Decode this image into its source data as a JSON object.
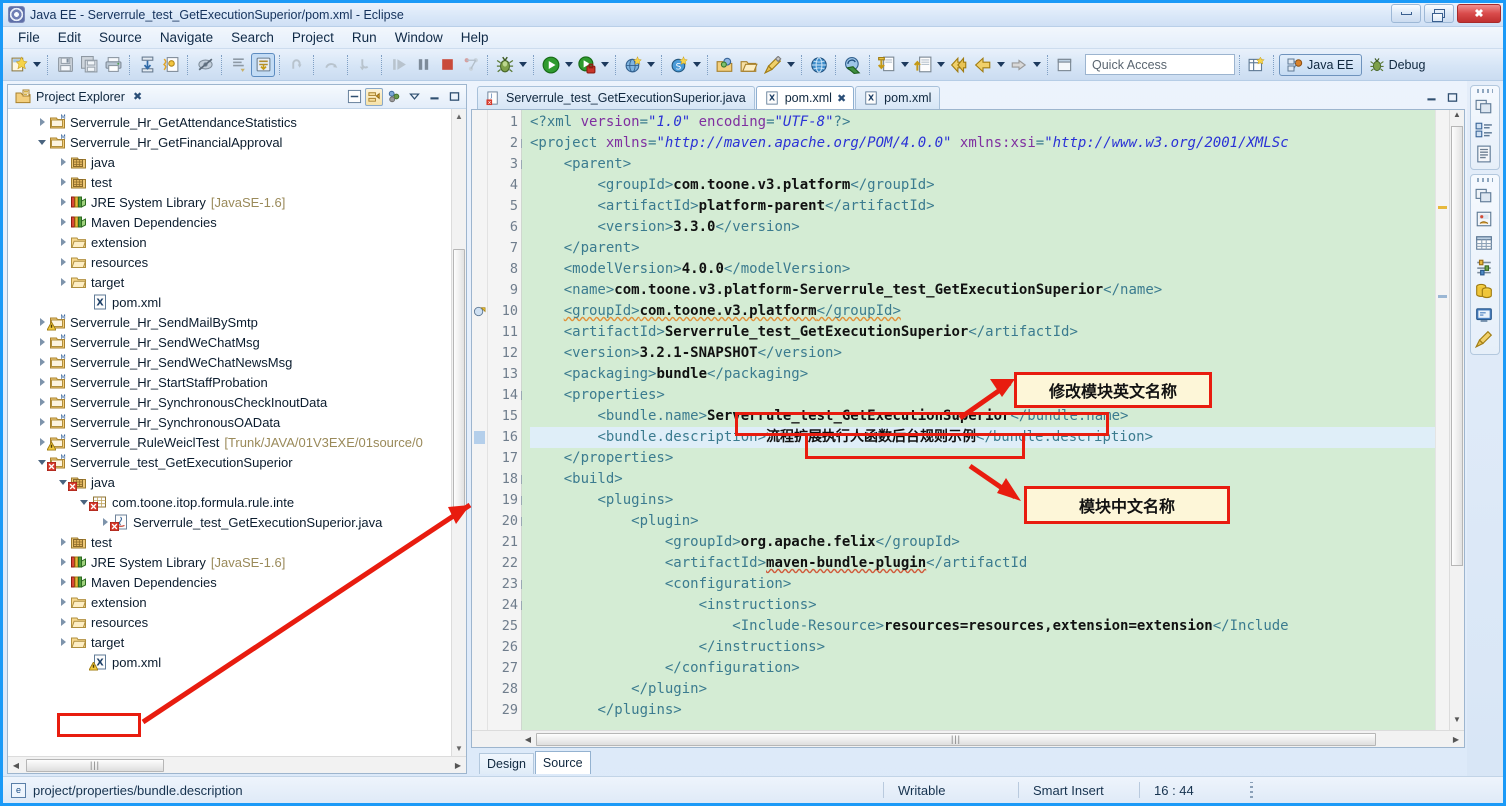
{
  "window": {
    "title": "Java EE - Serverrule_test_GetExecutionSuperior/pom.xml - Eclipse",
    "minimize_label": "Minimize",
    "maximize_label": "Restore",
    "close_label": "Close"
  },
  "menubar": {
    "items": [
      "File",
      "Edit",
      "Source",
      "Navigate",
      "Search",
      "Project",
      "Run",
      "Window",
      "Help"
    ]
  },
  "toolbar": {
    "quick_access_placeholder": "Quick Access",
    "perspectives": [
      {
        "label": "Java EE",
        "active": true
      },
      {
        "label": "Debug",
        "active": false
      }
    ],
    "items": [
      {
        "name": "new-wizard-icon",
        "has_arrow": true
      },
      {
        "name": "save-icon",
        "has_arrow": false
      },
      {
        "name": "save-all-icon",
        "has_arrow": false
      },
      {
        "name": "print-icon",
        "has_arrow": false
      },
      {
        "name": "publish-icon",
        "has_arrow": false
      },
      {
        "name": "validate-icon",
        "has_arrow": false
      },
      {
        "name": "toggle-mark-occurrences-icon",
        "has_arrow": false
      },
      {
        "name": "open-task-icon",
        "has_arrow": false
      },
      {
        "name": "skip-all-breakpoints-icon",
        "has_arrow": false
      },
      {
        "name": "step-return-icon",
        "has_arrow": false
      },
      {
        "name": "step-over-icon",
        "has_arrow": false
      },
      {
        "name": "step-into-icon",
        "has_arrow": false
      },
      {
        "name": "resume-icon",
        "has_arrow": false
      },
      {
        "name": "suspend-icon",
        "has_arrow": false
      },
      {
        "name": "terminate-icon",
        "has_arrow": false
      },
      {
        "name": "disconnect-icon",
        "has_arrow": false
      },
      {
        "name": "debug-icon",
        "has_arrow": true
      },
      {
        "name": "run-icon",
        "has_arrow": true
      },
      {
        "name": "run-external-tools-icon",
        "has_arrow": true
      },
      {
        "name": "new-server-icon",
        "has_arrow": true
      },
      {
        "name": "new-dynamic-web-project-icon",
        "has_arrow": true
      },
      {
        "name": "open-type-icon",
        "has_arrow": false
      },
      {
        "name": "open-resource-icon",
        "has_arrow": false
      },
      {
        "name": "search-icon",
        "has_arrow": true
      },
      {
        "name": "web-browser-icon",
        "has_arrow": false
      },
      {
        "name": "svn-update-icon",
        "has_arrow": false
      },
      {
        "name": "svn-commit-icon",
        "has_arrow": true
      },
      {
        "name": "svn-checkout-icon",
        "has_arrow": true
      },
      {
        "name": "previous-annotation-icon",
        "has_arrow": false
      },
      {
        "name": "back-icon",
        "has_arrow": true
      },
      {
        "name": "forward-icon",
        "has_arrow": true
      },
      {
        "name": "restore-icon",
        "has_arrow": false
      }
    ]
  },
  "explorer": {
    "view_title": "Project Explorer",
    "close_glyph": "✖",
    "toolbar_icons": [
      "collapse-all-icon",
      "link-with-editor-icon",
      "view-menu-filters-icon",
      "view-menu-icon",
      "minimize-icon",
      "maximize-icon"
    ],
    "tree": [
      {
        "label": "Serverrule_Hr_GetAttendanceStatistics",
        "indent": 1,
        "twisty": "right",
        "icon": "project",
        "overlay": "",
        "suffix": ""
      },
      {
        "label": "Serverrule_Hr_GetFinancialApproval",
        "indent": 1,
        "twisty": "down",
        "icon": "project",
        "overlay": "",
        "suffix": ""
      },
      {
        "label": "java",
        "indent": 2,
        "twisty": "right",
        "icon": "pkgroot",
        "overlay": "",
        "suffix": ""
      },
      {
        "label": "test",
        "indent": 2,
        "twisty": "right",
        "icon": "pkgroot",
        "overlay": "",
        "suffix": ""
      },
      {
        "label": "JRE System Library",
        "indent": 2,
        "twisty": "right",
        "icon": "lib",
        "overlay": "",
        "suffix": "[JavaSE-1.6]"
      },
      {
        "label": "Maven Dependencies",
        "indent": 2,
        "twisty": "right",
        "icon": "lib",
        "overlay": "",
        "suffix": ""
      },
      {
        "label": "extension",
        "indent": 2,
        "twisty": "right",
        "icon": "folder",
        "overlay": "",
        "suffix": ""
      },
      {
        "label": "resources",
        "indent": 2,
        "twisty": "right",
        "icon": "folder",
        "overlay": "",
        "suffix": ""
      },
      {
        "label": "target",
        "indent": 2,
        "twisty": "right",
        "icon": "folder",
        "overlay": "",
        "suffix": ""
      },
      {
        "label": "pom.xml",
        "indent": 3,
        "twisty": "none",
        "icon": "xml",
        "overlay": "",
        "suffix": ""
      },
      {
        "label": "Serverrule_Hr_SendMailBySmtp",
        "indent": 1,
        "twisty": "right",
        "icon": "project",
        "overlay": "warn",
        "suffix": ""
      },
      {
        "label": "Serverrule_Hr_SendWeChatMsg",
        "indent": 1,
        "twisty": "right",
        "icon": "project",
        "overlay": "",
        "suffix": ""
      },
      {
        "label": "Serverrule_Hr_SendWeChatNewsMsg",
        "indent": 1,
        "twisty": "right",
        "icon": "project",
        "overlay": "",
        "suffix": ""
      },
      {
        "label": "Serverrule_Hr_StartStaffProbation",
        "indent": 1,
        "twisty": "right",
        "icon": "project",
        "overlay": "",
        "suffix": ""
      },
      {
        "label": "Serverrule_Hr_SynchronousCheckInoutData",
        "indent": 1,
        "twisty": "right",
        "icon": "project",
        "overlay": "",
        "suffix": ""
      },
      {
        "label": "Serverrule_Hr_SynchronousOAData",
        "indent": 1,
        "twisty": "right",
        "icon": "project",
        "overlay": "",
        "suffix": ""
      },
      {
        "label": "Serverrule_RuleWeiclTest",
        "indent": 1,
        "twisty": "right",
        "icon": "project",
        "overlay": "warn",
        "suffix": "[Trunk/JAVA/01V3EXE/01source/0"
      },
      {
        "label": "Serverrule_test_GetExecutionSuperior",
        "indent": 1,
        "twisty": "down",
        "icon": "project",
        "overlay": "err",
        "suffix": ""
      },
      {
        "label": "java",
        "indent": 2,
        "twisty": "down",
        "icon": "pkgroot",
        "overlay": "err",
        "suffix": ""
      },
      {
        "label": "com.toone.itop.formula.rule.inte",
        "indent": 3,
        "twisty": "down",
        "icon": "pkg",
        "overlay": "err",
        "suffix": ""
      },
      {
        "label": "Serverrule_test_GetExecutionSuperior.java",
        "indent": 4,
        "twisty": "right",
        "icon": "java",
        "overlay": "err",
        "suffix": ""
      },
      {
        "label": "test",
        "indent": 2,
        "twisty": "right",
        "icon": "pkgroot",
        "overlay": "",
        "suffix": ""
      },
      {
        "label": "JRE System Library",
        "indent": 2,
        "twisty": "right",
        "icon": "lib",
        "overlay": "",
        "suffix": "[JavaSE-1.6]"
      },
      {
        "label": "Maven Dependencies",
        "indent": 2,
        "twisty": "right",
        "icon": "lib",
        "overlay": "",
        "suffix": ""
      },
      {
        "label": "extension",
        "indent": 2,
        "twisty": "right",
        "icon": "folder",
        "overlay": "",
        "suffix": ""
      },
      {
        "label": "resources",
        "indent": 2,
        "twisty": "right",
        "icon": "folder",
        "overlay": "",
        "suffix": ""
      },
      {
        "label": "target",
        "indent": 2,
        "twisty": "right",
        "icon": "folder",
        "overlay": "",
        "suffix": ""
      },
      {
        "label": "pom.xml",
        "indent": 3,
        "twisty": "none",
        "icon": "xml",
        "overlay": "warn",
        "suffix": ""
      }
    ]
  },
  "editor": {
    "tabs": [
      {
        "label": "Serverrule_test_GetExecutionSuperior.java",
        "icon": "java-file-icon",
        "active": false,
        "closable": false
      },
      {
        "label": "pom.xml",
        "icon": "xml-file-icon",
        "active": true,
        "closable": true
      },
      {
        "label": "pom.xml",
        "icon": "xml-file-icon",
        "active": false,
        "closable": false
      }
    ],
    "close_glyph": "✖",
    "bottom_tabs": [
      {
        "label": "Design",
        "active": false
      },
      {
        "label": "Source",
        "active": true
      }
    ],
    "lines": [
      {
        "n": 1,
        "fold": "",
        "marker": "",
        "current": false,
        "html": "<span class=\"pi\">&lt;?xml </span><span class=\"attn\">version</span><span class=\"pi\">=</span><span class=\"attv\">\"1.0\"</span> <span class=\"attn\">encoding</span><span class=\"pi\">=</span><span class=\"attv\">\"UTF-8\"</span><span class=\"pi\">?&gt;</span>"
      },
      {
        "n": 2,
        "fold": "-",
        "marker": "",
        "current": false,
        "html": "<span class=\"tag\">&lt;project </span><span class=\"attn\">xmlns</span><span class=\"tag\">=</span><span class=\"attv\">\"http://maven.apache.org/POM/4.0.0\"</span> <span class=\"attn\">xmlns:xsi</span><span class=\"tag\">=</span><span class=\"attv\">\"http://www.w3.org/2001/XMLSc</span>"
      },
      {
        "n": 3,
        "fold": "-",
        "marker": "",
        "current": false,
        "html": "    <span class=\"tag\">&lt;parent&gt;</span>"
      },
      {
        "n": 4,
        "fold": "",
        "marker": "",
        "current": false,
        "html": "        <span class=\"tag\">&lt;groupId&gt;</span><span class=\"txt\">com.toone.v3.platform</span><span class=\"tag\">&lt;/groupId&gt;</span>"
      },
      {
        "n": 5,
        "fold": "",
        "marker": "",
        "current": false,
        "html": "        <span class=\"tag\">&lt;artifactId&gt;</span><span class=\"txt\">platform-parent</span><span class=\"tag\">&lt;/artifactId&gt;</span>"
      },
      {
        "n": 6,
        "fold": "",
        "marker": "",
        "current": false,
        "html": "        <span class=\"tag\">&lt;version&gt;</span><span class=\"txt\">3.3.0</span><span class=\"tag\">&lt;/version&gt;</span>"
      },
      {
        "n": 7,
        "fold": "",
        "marker": "",
        "current": false,
        "html": "    <span class=\"tag\">&lt;/parent&gt;</span>"
      },
      {
        "n": 8,
        "fold": "",
        "marker": "",
        "current": false,
        "html": "    <span class=\"tag\">&lt;modelVersion&gt;</span><span class=\"txt\">4.0.0</span><span class=\"tag\">&lt;/modelVersion&gt;</span>"
      },
      {
        "n": 9,
        "fold": "",
        "marker": "",
        "current": false,
        "html": "    <span class=\"tag\">&lt;name&gt;</span><span class=\"txt\">com.toone.v3.platform-Serverrule_test_GetExecutionSuperior</span><span class=\"tag\">&lt;/name&gt;</span>"
      },
      {
        "n": 10,
        "fold": "",
        "marker": "warning",
        "current": false,
        "html": "    <span class=\"tag squig\">&lt;groupId&gt;</span><span class=\"txt squig\">com.toone.v3.platform</span><span class=\"tag squig\">&lt;/groupId&gt;</span>"
      },
      {
        "n": 11,
        "fold": "",
        "marker": "",
        "current": false,
        "html": "    <span class=\"tag\">&lt;artifactId&gt;</span><span class=\"txt\">Serverrule_test_GetExecutionSuperior</span><span class=\"tag\">&lt;/artifactId&gt;</span>"
      },
      {
        "n": 12,
        "fold": "",
        "marker": "",
        "current": false,
        "html": "    <span class=\"tag\">&lt;version&gt;</span><span class=\"txt\">3.2.1-SNAPSHOT</span><span class=\"tag\">&lt;/version&gt;</span>"
      },
      {
        "n": 13,
        "fold": "",
        "marker": "",
        "current": false,
        "html": "    <span class=\"tag\">&lt;packaging&gt;</span><span class=\"txt\">bundle</span><span class=\"tag\">&lt;/packaging&gt;</span>"
      },
      {
        "n": 14,
        "fold": "-",
        "marker": "",
        "current": false,
        "html": "    <span class=\"tag\">&lt;properties&gt;</span>"
      },
      {
        "n": 15,
        "fold": "",
        "marker": "",
        "current": false,
        "html": "        <span class=\"tag\">&lt;bundle.name&gt;</span><span class=\"txt\">Serverrule_test_GetExecutionSuperior</span><span class=\"tag\">&lt;/bundle.name&gt;</span>"
      },
      {
        "n": 16,
        "fold": "",
        "marker": "caret",
        "current": true,
        "html": "        <span class=\"tag\">&lt;bundle.description&gt;</span><span class=\"txt\">流程扩展执行人函数后台规则示例</span><span class=\"tag\">&lt;/bundle.description&gt;</span>"
      },
      {
        "n": 17,
        "fold": "",
        "marker": "",
        "current": false,
        "html": "    <span class=\"tag\">&lt;/properties&gt;</span>"
      },
      {
        "n": 18,
        "fold": "-",
        "marker": "",
        "current": false,
        "html": "    <span class=\"tag\">&lt;build&gt;</span>"
      },
      {
        "n": 19,
        "fold": "-",
        "marker": "",
        "current": false,
        "html": "        <span class=\"tag\">&lt;plugins&gt;</span>"
      },
      {
        "n": 20,
        "fold": "-",
        "marker": "",
        "current": false,
        "html": "            <span class=\"tag\">&lt;plugin&gt;</span>"
      },
      {
        "n": 21,
        "fold": "",
        "marker": "",
        "current": false,
        "html": "                <span class=\"tag\">&lt;groupId&gt;</span><span class=\"txt\">org.apache.felix</span><span class=\"tag\">&lt;/groupId&gt;</span>"
      },
      {
        "n": 22,
        "fold": "",
        "marker": "",
        "current": false,
        "html": "                <span class=\"tag\">&lt;artifactId&gt;</span><span class=\"txt squig-r\">maven-bundle-plugin</span><span class=\"tag\">&lt;/artifactId</span>"
      },
      {
        "n": 23,
        "fold": "-",
        "marker": "",
        "current": false,
        "html": "                <span class=\"tag\">&lt;configuration&gt;</span>"
      },
      {
        "n": 24,
        "fold": "-",
        "marker": "",
        "current": false,
        "html": "                    <span class=\"tag\">&lt;instructions&gt;</span>"
      },
      {
        "n": 25,
        "fold": "",
        "marker": "",
        "current": false,
        "html": "                        <span class=\"tag\">&lt;Include-Resource&gt;</span><span class=\"txt\">resources=resources,extension=extension</span><span class=\"tag\">&lt;/Include</span>"
      },
      {
        "n": 26,
        "fold": "",
        "marker": "",
        "current": false,
        "html": "                    <span class=\"tag\">&lt;/instructions&gt;</span>"
      },
      {
        "n": 27,
        "fold": "",
        "marker": "",
        "current": false,
        "html": "                <span class=\"tag\">&lt;/configuration&gt;</span>"
      },
      {
        "n": 28,
        "fold": "",
        "marker": "",
        "current": false,
        "html": "            <span class=\"tag\">&lt;/plugin&gt;</span>"
      },
      {
        "n": 29,
        "fold": "",
        "marker": "",
        "current": false,
        "html": "        <span class=\"tag\">&lt;/plugins&gt;</span>"
      }
    ]
  },
  "fastview": {
    "groups": [
      {
        "icons": [
          "restore-view-icon",
          "outline-view-icon",
          "properties-view-icon"
        ]
      },
      {
        "icons": [
          "restore-view-icon",
          "servers-view-icon",
          "data-source-explorer-icon",
          "snippets-view-icon",
          "database-icon",
          "console-icon",
          "markers-icon"
        ]
      }
    ]
  },
  "statusbar": {
    "selection_path": "project/properties/bundle.description",
    "writable": "Writable",
    "insert_mode": "Smart Insert",
    "cursor_position": "16 : 44"
  },
  "annotations": {
    "callout_english_name": "修改模块英文名称",
    "callout_chinese_name": "模块中文名称",
    "highlight_color": "#e81c0f",
    "highlighted_values": [
      "Serverrule_test_GetExecutionSuperior",
      "流程扩展执行人函数后台规则示例",
      "pom.xml"
    ]
  }
}
